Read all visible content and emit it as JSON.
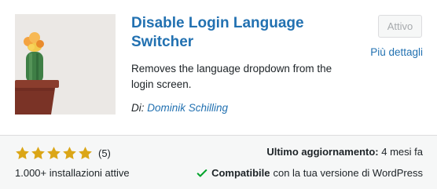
{
  "plugin": {
    "title": "Disable Login Language Switcher",
    "description": "Removes the language dropdown from the login screen.",
    "author_prefix": "Di:",
    "author_name": "Dominik Schilling"
  },
  "actions": {
    "active_label": "Attivo",
    "more_details_label": "Più dettagli"
  },
  "footer": {
    "rating_stars": 5,
    "rating_count": "(5)",
    "installs": "1.000+ installazioni attive",
    "last_updated_label": "Ultimo aggiornamento:",
    "last_updated_value": "4 mesi fa",
    "compatible_label": "Compatibile",
    "compatible_text": "con la tua versione di WordPress"
  },
  "colors": {
    "link": "#2271b1",
    "star": "#dba617",
    "check": "#00a32a"
  },
  "icons": {
    "thumbnail": "cactus-pot-image",
    "star": "star-icon",
    "check": "check-icon"
  }
}
